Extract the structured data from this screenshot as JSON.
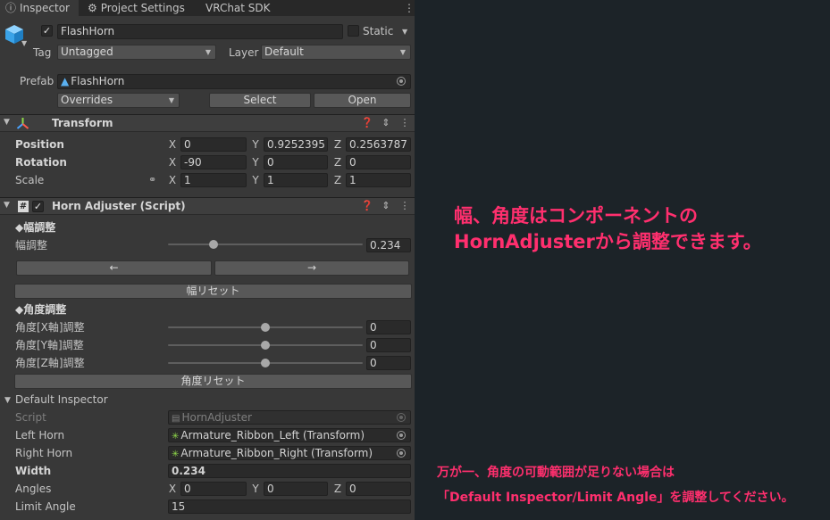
{
  "tabs": [
    {
      "label": "Inspector",
      "icon": "info-icon"
    },
    {
      "label": "Project Settings",
      "icon": "gear-icon"
    },
    {
      "label": "VRChat SDK",
      "icon": ""
    }
  ],
  "object": {
    "name": "FlashHorn",
    "active": true,
    "static_label": "Static",
    "tag_label": "Tag",
    "tag_value": "Untagged",
    "layer_label": "Layer",
    "layer_value": "Default"
  },
  "prefab": {
    "label": "Prefab",
    "asset": "FlashHorn",
    "overrides": "Overrides",
    "select": "Select",
    "open": "Open"
  },
  "transform": {
    "title": "Transform",
    "position": {
      "label": "Position",
      "x": "0",
      "y": "0.9252395",
      "z": "0.2563787"
    },
    "rotation": {
      "label": "Rotation",
      "x": "-90",
      "y": "0",
      "z": "0"
    },
    "scale": {
      "label": "Scale",
      "x": "1",
      "y": "1",
      "z": "1"
    },
    "axis_x": "X",
    "axis_y": "Y",
    "axis_z": "Z"
  },
  "horn": {
    "title": "Horn Adjuster (Script)",
    "width_header": "◆幅調整",
    "width_label": "幅調整",
    "width_value": "0.234",
    "width_fraction": 0.234,
    "left_arrow": "←",
    "right_arrow": "→",
    "width_reset": "幅リセット",
    "angle_header": "◆角度調整",
    "angle_rows": [
      {
        "label": "角度[X軸]調整",
        "value": "0"
      },
      {
        "label": "角度[Y軸]調整",
        "value": "0"
      },
      {
        "label": "角度[Z軸]調整",
        "value": "0"
      }
    ],
    "angle_reset": "角度リセット"
  },
  "default_inspector": {
    "title": "Default Inspector",
    "script_label": "Script",
    "script_value": "HornAdjuster",
    "left_horn_label": "Left Horn",
    "left_horn_value": "Armature_Ribbon_Left (Transform)",
    "right_horn_label": "Right Horn",
    "right_horn_value": "Armature_Ribbon_Right (Transform)",
    "width_label": "Width",
    "width_value": "0.234",
    "angles_label": "Angles",
    "angles": {
      "x": "0",
      "y": "0",
      "z": "0"
    },
    "limit_label": "Limit Angle",
    "limit_value": "15"
  },
  "annotations": {
    "note1_line1": "幅、角度はコンポーネントの",
    "note1_line2": "HornAdjusterから調整できます。",
    "note2_line1": "万が一、角度の可動範囲が足りない場合は",
    "note2_line2": "「Default Inspector/Limit Angle」を調整してください。"
  },
  "colors": {
    "panel": "#383838",
    "background": "#1c2328",
    "annotation": "#ff2f6e"
  }
}
